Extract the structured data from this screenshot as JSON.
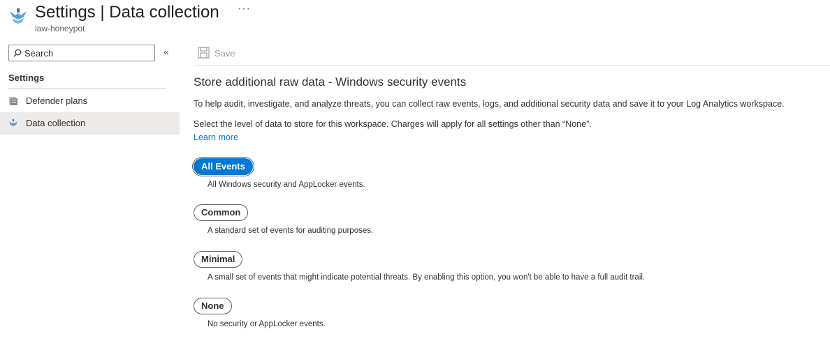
{
  "header": {
    "title": "Settings | Data collection",
    "subtitle": "law-honeypot",
    "more_label": "···"
  },
  "sidebar": {
    "search_placeholder": "Search",
    "collapse_label": "«",
    "section_title": "Settings",
    "items": [
      {
        "label": "Defender plans",
        "icon": "defender-plans-icon",
        "selected": false
      },
      {
        "label": "Data collection",
        "icon": "data-collection-icon",
        "selected": true
      }
    ]
  },
  "toolbar": {
    "save_label": "Save",
    "save_enabled": false
  },
  "main": {
    "heading": "Store additional raw data - Windows security events",
    "description": "To help audit, investigate, and analyze threats, you can collect raw events, logs, and additional security data and save it to your Log Analytics workspace.",
    "select_text": "Select the level of data to store for this workspace. Charges will apply for all settings other than “None”.",
    "learn_more": "Learn more",
    "options": [
      {
        "label": "All Events",
        "description": "All Windows security and AppLocker events.",
        "selected": true
      },
      {
        "label": "Common",
        "description": "A standard set of events for auditing purposes.",
        "selected": false
      },
      {
        "label": "Minimal",
        "description": "A small set of events that might indicate potential threats. By enabling this option, you won't be able to have a full audit trail.",
        "selected": false
      },
      {
        "label": "None",
        "description": "No security or AppLocker events.",
        "selected": false
      }
    ]
  },
  "colors": {
    "accent": "#0078d4",
    "selected_row": "#edebe9",
    "disabled_text": "#a19f9d"
  }
}
